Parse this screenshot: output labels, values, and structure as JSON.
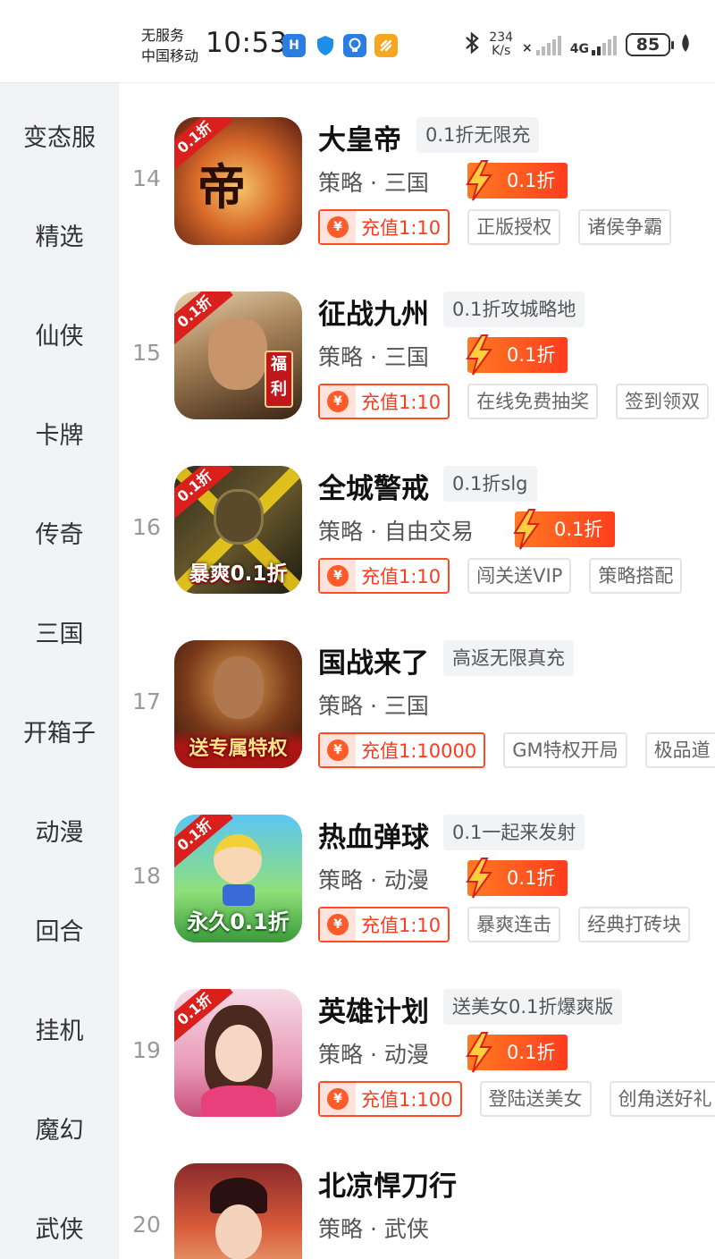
{
  "status_bar": {
    "carrier_line1": "无服务",
    "carrier_line2": "中国移动",
    "time": "10:53",
    "net_speed_value": "234",
    "net_speed_unit": "K/s",
    "network": "4G",
    "battery": "85"
  },
  "sidebar": {
    "items": [
      "变态服",
      "精选",
      "仙侠",
      "卡牌",
      "传奇",
      "三国",
      "开箱子",
      "动漫",
      "回合",
      "挂机",
      "魔幻",
      "武侠"
    ]
  },
  "games": [
    {
      "rank": "14",
      "title": "大皇帝",
      "subtag": "0.1折无限充",
      "genre": "策略",
      "theme": "三国",
      "discount": "0.1折",
      "recharge": "充值1:10",
      "tags": [
        "正版授权",
        "诸侯争霸"
      ],
      "icon_badge": "0.1折",
      "icon_caption": ""
    },
    {
      "rank": "15",
      "title": "征战九州",
      "subtag": "0.1折攻城略地",
      "genre": "策略",
      "theme": "三国",
      "discount": "0.1折",
      "recharge": "充值1:10",
      "tags": [
        "在线免费抽奖",
        "签到领双"
      ],
      "icon_badge": "0.1折",
      "icon_caption": ""
    },
    {
      "rank": "16",
      "title": "全城警戒",
      "subtag": "0.1折slg",
      "genre": "策略",
      "theme": "自由交易",
      "discount": "0.1折",
      "recharge": "充值1:10",
      "tags": [
        "闯关送VIP",
        "策略搭配"
      ],
      "icon_badge": "0.1折",
      "icon_caption": "暴爽0.1折"
    },
    {
      "rank": "17",
      "title": "国战来了",
      "subtag": "高返无限真充",
      "genre": "策略",
      "theme": "三国",
      "discount": "",
      "recharge": "充值1:10000",
      "tags": [
        "GM特权开局",
        "极品道"
      ],
      "icon_badge": "",
      "icon_caption": "送专属特权"
    },
    {
      "rank": "18",
      "title": "热血弹球",
      "subtag": "0.1一起来发射",
      "genre": "策略",
      "theme": "动漫",
      "discount": "0.1折",
      "recharge": "充值1:10",
      "tags": [
        "暴爽连击",
        "经典打砖块"
      ],
      "icon_badge": "0.1折",
      "icon_caption": "永久0.1折"
    },
    {
      "rank": "19",
      "title": "英雄计划",
      "subtag": "送美女0.1折爆爽版",
      "genre": "策略",
      "theme": "动漫",
      "discount": "0.1折",
      "recharge": "充值1:100",
      "tags": [
        "登陆送美女",
        "创角送好礼"
      ],
      "icon_badge": "0.1折",
      "icon_caption": ""
    },
    {
      "rank": "20",
      "title": "北凉悍刀行",
      "subtag": "",
      "genre": "策略",
      "theme": "武侠",
      "discount": "",
      "recharge": "",
      "tags": [],
      "icon_badge": "",
      "icon_caption": ""
    }
  ],
  "colors": {
    "accent": "#ff4a24",
    "sidebar_bg": "#f2f3f5"
  }
}
